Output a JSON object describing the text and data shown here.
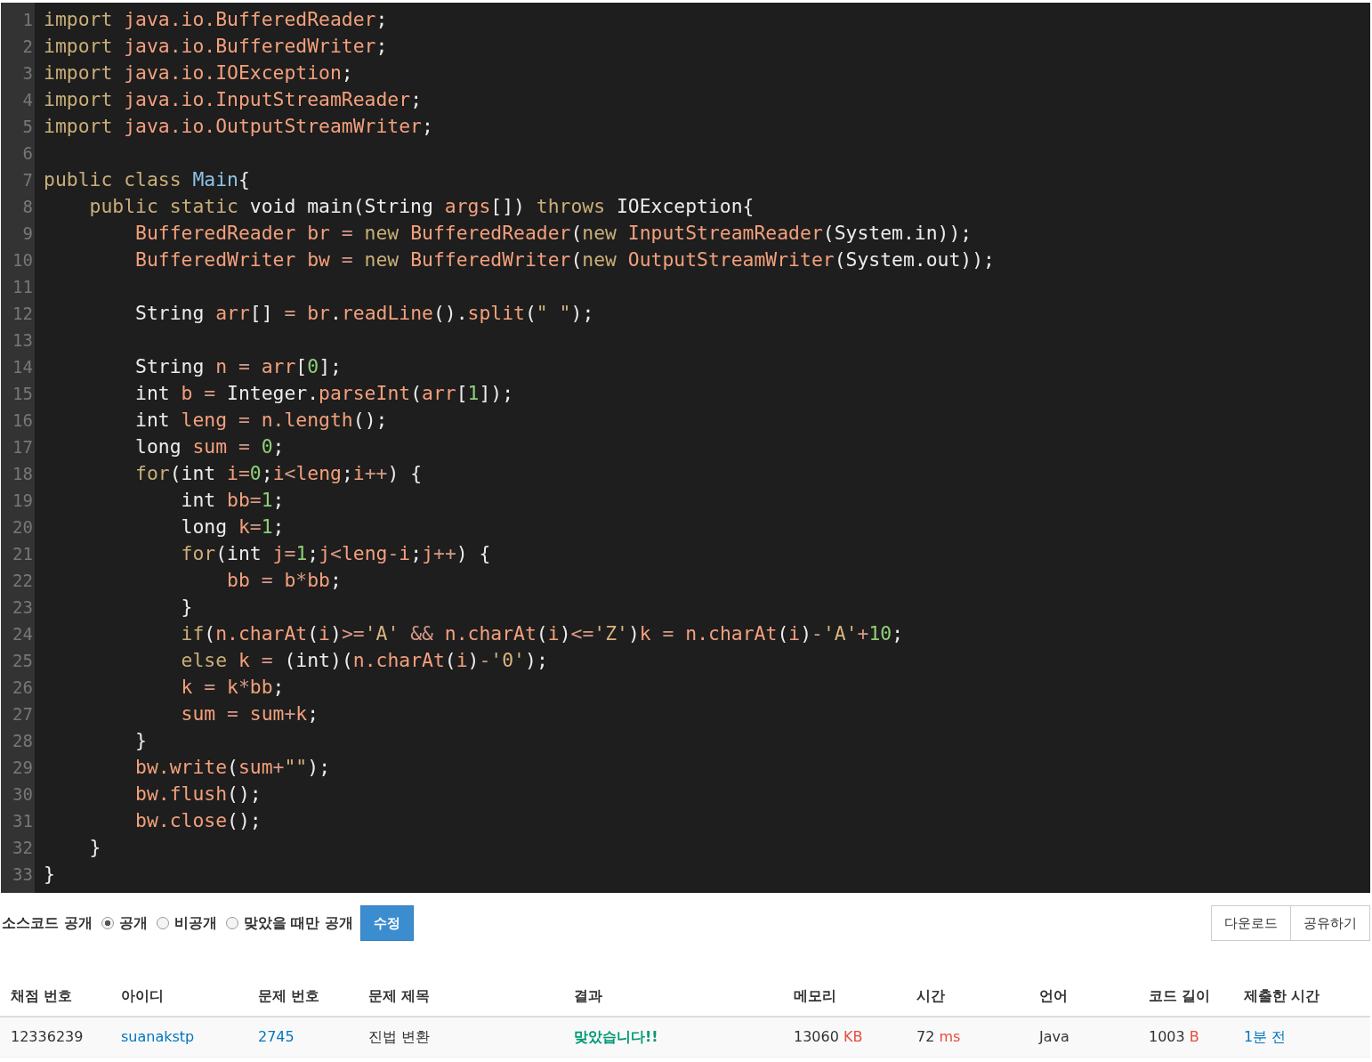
{
  "editor": {
    "lines": [
      {
        "number": "1",
        "tokens": [
          {
            "kind": "kw",
            "text": "import "
          },
          {
            "kind": "id",
            "text": "java.io.BufferedReader"
          },
          {
            "kind": "p",
            "text": ";"
          }
        ]
      },
      {
        "number": "2",
        "tokens": [
          {
            "kind": "kw",
            "text": "import "
          },
          {
            "kind": "id",
            "text": "java.io.BufferedWriter"
          },
          {
            "kind": "p",
            "text": ";"
          }
        ]
      },
      {
        "number": "3",
        "tokens": [
          {
            "kind": "kw",
            "text": "import "
          },
          {
            "kind": "id",
            "text": "java.io.IOException"
          },
          {
            "kind": "p",
            "text": ";"
          }
        ]
      },
      {
        "number": "4",
        "tokens": [
          {
            "kind": "kw",
            "text": "import "
          },
          {
            "kind": "id",
            "text": "java.io.InputStreamReader"
          },
          {
            "kind": "p",
            "text": ";"
          }
        ]
      },
      {
        "number": "5",
        "tokens": [
          {
            "kind": "kw",
            "text": "import "
          },
          {
            "kind": "id",
            "text": "java.io.OutputStreamWriter"
          },
          {
            "kind": "p",
            "text": ";"
          }
        ]
      },
      {
        "number": "6"
      },
      {
        "number": "7",
        "tokens": [
          {
            "kind": "kw",
            "text": "public class "
          },
          {
            "kind": "cls",
            "text": "Main"
          },
          {
            "kind": "p",
            "text": "{"
          }
        ]
      },
      {
        "number": "8",
        "tokens": [
          {
            "kind": "kw",
            "text": "    public static "
          },
          {
            "kind": "type",
            "text": "void main(String "
          },
          {
            "kind": "id",
            "text": "args"
          },
          {
            "kind": "p",
            "text": "[]) "
          },
          {
            "kind": "kw",
            "text": "throws "
          },
          {
            "kind": "type",
            "text": "IOException{"
          }
        ]
      },
      {
        "number": "9",
        "tokens": [
          {
            "kind": "id",
            "text": "        BufferedReader br "
          },
          {
            "kind": "op",
            "text": "= "
          },
          {
            "kind": "kw",
            "text": "new "
          },
          {
            "kind": "id",
            "text": "BufferedReader"
          },
          {
            "kind": "p",
            "text": "("
          },
          {
            "kind": "kw",
            "text": "new "
          },
          {
            "kind": "id",
            "text": "InputStreamReader"
          },
          {
            "kind": "p",
            "text": "(System.in));"
          }
        ]
      },
      {
        "number": "10",
        "tokens": [
          {
            "kind": "id",
            "text": "        BufferedWriter bw "
          },
          {
            "kind": "op",
            "text": "= "
          },
          {
            "kind": "kw",
            "text": "new "
          },
          {
            "kind": "id",
            "text": "BufferedWriter"
          },
          {
            "kind": "p",
            "text": "("
          },
          {
            "kind": "kw",
            "text": "new "
          },
          {
            "kind": "id",
            "text": "OutputStreamWriter"
          },
          {
            "kind": "p",
            "text": "(System.out));"
          }
        ]
      },
      {
        "number": "11"
      },
      {
        "number": "12",
        "tokens": [
          {
            "kind": "type",
            "text": "        String "
          },
          {
            "kind": "id",
            "text": "arr"
          },
          {
            "kind": "p",
            "text": "[] "
          },
          {
            "kind": "op",
            "text": "= "
          },
          {
            "kind": "id",
            "text": "br"
          },
          {
            "kind": "p",
            "text": "."
          },
          {
            "kind": "id",
            "text": "readLine"
          },
          {
            "kind": "p",
            "text": "()."
          },
          {
            "kind": "id",
            "text": "split"
          },
          {
            "kind": "p",
            "text": "("
          },
          {
            "kind": "str",
            "text": "\" \""
          },
          {
            "kind": "p",
            "text": ");"
          }
        ]
      },
      {
        "number": "13"
      },
      {
        "number": "14",
        "tokens": [
          {
            "kind": "type",
            "text": "        String "
          },
          {
            "kind": "id",
            "text": "n "
          },
          {
            "kind": "op",
            "text": "= "
          },
          {
            "kind": "id",
            "text": "arr"
          },
          {
            "kind": "p",
            "text": "["
          },
          {
            "kind": "num",
            "text": "0"
          },
          {
            "kind": "p",
            "text": "];"
          }
        ]
      },
      {
        "number": "15",
        "tokens": [
          {
            "kind": "type",
            "text": "        int "
          },
          {
            "kind": "id",
            "text": "b "
          },
          {
            "kind": "op",
            "text": "= "
          },
          {
            "kind": "type",
            "text": "Integer."
          },
          {
            "kind": "id",
            "text": "parseInt"
          },
          {
            "kind": "p",
            "text": "("
          },
          {
            "kind": "id",
            "text": "arr"
          },
          {
            "kind": "p",
            "text": "["
          },
          {
            "kind": "num",
            "text": "1"
          },
          {
            "kind": "p",
            "text": "]);"
          }
        ]
      },
      {
        "number": "16",
        "tokens": [
          {
            "kind": "type",
            "text": "        int "
          },
          {
            "kind": "id",
            "text": "leng "
          },
          {
            "kind": "op",
            "text": "= "
          },
          {
            "kind": "id",
            "text": "n.length"
          },
          {
            "kind": "p",
            "text": "();"
          }
        ]
      },
      {
        "number": "17",
        "tokens": [
          {
            "kind": "type",
            "text": "        long "
          },
          {
            "kind": "id",
            "text": "sum "
          },
          {
            "kind": "op",
            "text": "= "
          },
          {
            "kind": "num",
            "text": "0"
          },
          {
            "kind": "p",
            "text": ";"
          }
        ]
      },
      {
        "number": "18",
        "tokens": [
          {
            "kind": "kw",
            "text": "        for"
          },
          {
            "kind": "p",
            "text": "("
          },
          {
            "kind": "type",
            "text": "int "
          },
          {
            "kind": "id",
            "text": "i"
          },
          {
            "kind": "op",
            "text": "="
          },
          {
            "kind": "num",
            "text": "0"
          },
          {
            "kind": "p",
            "text": ";"
          },
          {
            "kind": "id",
            "text": "i"
          },
          {
            "kind": "op",
            "text": "<"
          },
          {
            "kind": "id",
            "text": "leng"
          },
          {
            "kind": "p",
            "text": ";"
          },
          {
            "kind": "id",
            "text": "i"
          },
          {
            "kind": "op",
            "text": "++"
          },
          {
            "kind": "p",
            "text": ") {"
          }
        ]
      },
      {
        "number": "19",
        "tokens": [
          {
            "kind": "type",
            "text": "            int "
          },
          {
            "kind": "id",
            "text": "bb"
          },
          {
            "kind": "op",
            "text": "="
          },
          {
            "kind": "num",
            "text": "1"
          },
          {
            "kind": "p",
            "text": ";"
          }
        ]
      },
      {
        "number": "20",
        "tokens": [
          {
            "kind": "type",
            "text": "            long "
          },
          {
            "kind": "id",
            "text": "k"
          },
          {
            "kind": "op",
            "text": "="
          },
          {
            "kind": "num",
            "text": "1"
          },
          {
            "kind": "p",
            "text": ";"
          }
        ]
      },
      {
        "number": "21",
        "tokens": [
          {
            "kind": "kw",
            "text": "            for"
          },
          {
            "kind": "p",
            "text": "("
          },
          {
            "kind": "type",
            "text": "int "
          },
          {
            "kind": "id",
            "text": "j"
          },
          {
            "kind": "op",
            "text": "="
          },
          {
            "kind": "num",
            "text": "1"
          },
          {
            "kind": "p",
            "text": ";"
          },
          {
            "kind": "id",
            "text": "j"
          },
          {
            "kind": "op",
            "text": "<"
          },
          {
            "kind": "id",
            "text": "leng"
          },
          {
            "kind": "op",
            "text": "-"
          },
          {
            "kind": "id",
            "text": "i"
          },
          {
            "kind": "p",
            "text": ";"
          },
          {
            "kind": "id",
            "text": "j"
          },
          {
            "kind": "op",
            "text": "++"
          },
          {
            "kind": "p",
            "text": ") {"
          }
        ]
      },
      {
        "number": "22",
        "tokens": [
          {
            "kind": "id",
            "text": "                bb "
          },
          {
            "kind": "op",
            "text": "= "
          },
          {
            "kind": "id",
            "text": "b"
          },
          {
            "kind": "op",
            "text": "*"
          },
          {
            "kind": "id",
            "text": "bb"
          },
          {
            "kind": "p",
            "text": ";"
          }
        ]
      },
      {
        "number": "23",
        "tokens": [
          {
            "kind": "p",
            "text": "            }"
          }
        ]
      },
      {
        "number": "24",
        "tokens": [
          {
            "kind": "kw",
            "text": "            if"
          },
          {
            "kind": "p",
            "text": "("
          },
          {
            "kind": "id",
            "text": "n.charAt"
          },
          {
            "kind": "p",
            "text": "("
          },
          {
            "kind": "id",
            "text": "i"
          },
          {
            "kind": "p",
            "text": ")"
          },
          {
            "kind": "op",
            "text": ">="
          },
          {
            "kind": "str",
            "text": "'A' "
          },
          {
            "kind": "op",
            "text": "&& "
          },
          {
            "kind": "id",
            "text": "n.charAt"
          },
          {
            "kind": "p",
            "text": "("
          },
          {
            "kind": "id",
            "text": "i"
          },
          {
            "kind": "p",
            "text": ")"
          },
          {
            "kind": "op",
            "text": "<="
          },
          {
            "kind": "str",
            "text": "'Z'"
          },
          {
            "kind": "p",
            "text": ")"
          },
          {
            "kind": "id",
            "text": "k "
          },
          {
            "kind": "op",
            "text": "= "
          },
          {
            "kind": "id",
            "text": "n.charAt"
          },
          {
            "kind": "p",
            "text": "("
          },
          {
            "kind": "id",
            "text": "i"
          },
          {
            "kind": "p",
            "text": ")"
          },
          {
            "kind": "op",
            "text": "-"
          },
          {
            "kind": "str",
            "text": "'A'"
          },
          {
            "kind": "op",
            "text": "+"
          },
          {
            "kind": "num",
            "text": "10"
          },
          {
            "kind": "p",
            "text": ";"
          }
        ]
      },
      {
        "number": "25",
        "tokens": [
          {
            "kind": "kw",
            "text": "            else "
          },
          {
            "kind": "id",
            "text": "k "
          },
          {
            "kind": "op",
            "text": "= "
          },
          {
            "kind": "p",
            "text": "("
          },
          {
            "kind": "type",
            "text": "int"
          },
          {
            "kind": "p",
            "text": ")("
          },
          {
            "kind": "id",
            "text": "n.charAt"
          },
          {
            "kind": "p",
            "text": "("
          },
          {
            "kind": "id",
            "text": "i"
          },
          {
            "kind": "p",
            "text": ")"
          },
          {
            "kind": "op",
            "text": "-"
          },
          {
            "kind": "str",
            "text": "'0'"
          },
          {
            "kind": "p",
            "text": ");"
          }
        ]
      },
      {
        "number": "26",
        "tokens": [
          {
            "kind": "id",
            "text": "            k "
          },
          {
            "kind": "op",
            "text": "= "
          },
          {
            "kind": "id",
            "text": "k"
          },
          {
            "kind": "op",
            "text": "*"
          },
          {
            "kind": "id",
            "text": "bb"
          },
          {
            "kind": "p",
            "text": ";"
          }
        ]
      },
      {
        "number": "27",
        "tokens": [
          {
            "kind": "id",
            "text": "            sum "
          },
          {
            "kind": "op",
            "text": "= "
          },
          {
            "kind": "id",
            "text": "sum"
          },
          {
            "kind": "op",
            "text": "+"
          },
          {
            "kind": "id",
            "text": "k"
          },
          {
            "kind": "p",
            "text": ";"
          }
        ]
      },
      {
        "number": "28",
        "tokens": [
          {
            "kind": "p",
            "text": "        }"
          }
        ]
      },
      {
        "number": "29",
        "tokens": [
          {
            "kind": "id",
            "text": "        bw.write"
          },
          {
            "kind": "p",
            "text": "("
          },
          {
            "kind": "id",
            "text": "sum"
          },
          {
            "kind": "op",
            "text": "+"
          },
          {
            "kind": "str",
            "text": "\"\""
          },
          {
            "kind": "p",
            "text": ");"
          }
        ]
      },
      {
        "number": "30",
        "tokens": [
          {
            "kind": "id",
            "text": "        bw.flush"
          },
          {
            "kind": "p",
            "text": "();"
          }
        ]
      },
      {
        "number": "31",
        "tokens": [
          {
            "kind": "id",
            "text": "        bw.close"
          },
          {
            "kind": "p",
            "text": "();"
          }
        ]
      },
      {
        "number": "32",
        "tokens": [
          {
            "kind": "p",
            "text": "    }"
          }
        ]
      },
      {
        "number": "33",
        "tokens": [
          {
            "kind": "p",
            "text": "}"
          }
        ]
      }
    ]
  },
  "visibility": {
    "label": "소스코드 공개",
    "options": [
      {
        "label": "공개",
        "selected": true
      },
      {
        "label": "비공개",
        "selected": false
      },
      {
        "label": "맞았을 때만 공개",
        "selected": false
      }
    ],
    "button": "수정"
  },
  "actions": [
    "다운로드",
    "공유하기"
  ],
  "table": {
    "columns": [
      "채점 번호",
      "아이디",
      "문제 번호",
      "문제 제목",
      "결과",
      "메모리",
      "시간",
      "언어",
      "코드 길이",
      "제출한 시간"
    ],
    "rows": [
      [
        {
          "kind": "plain",
          "text": "12336239"
        },
        {
          "kind": "link",
          "text": "suanakstp"
        },
        {
          "kind": "link",
          "text": "2745"
        },
        {
          "kind": "plain",
          "text": "진법 변환"
        },
        {
          "kind": "result",
          "text": "맞았습니다!!"
        },
        {
          "kind": "unit",
          "text": "13060",
          "unit": "KB"
        },
        {
          "kind": "unit",
          "text": "72",
          "unit": "ms"
        },
        {
          "kind": "plain",
          "text": "Java"
        },
        {
          "kind": "unit",
          "text": "1003",
          "unit": "B"
        },
        {
          "kind": "link",
          "text": "1분 전"
        }
      ]
    ]
  }
}
